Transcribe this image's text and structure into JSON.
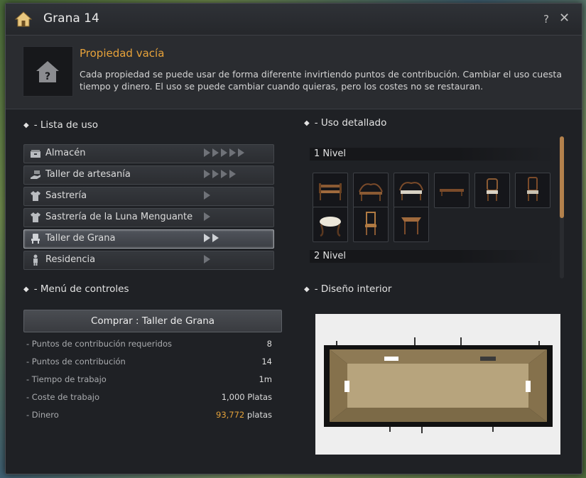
{
  "window": {
    "title": "Grana 14",
    "help_label": "?",
    "close_label": "✕"
  },
  "info": {
    "title": "Propiedad vacía",
    "description": "Cada propiedad se puede usar de forma diferente invirtiendo puntos de contribución. Cambiar el uso cuesta tiempo y dinero. El uso se puede cambiar cuando quieras, pero los costes no se restauran."
  },
  "use_list": {
    "heading": "- Lista de uso",
    "items": [
      {
        "label": "Almacén",
        "icon": "storage-icon",
        "level": 5,
        "selected": false
      },
      {
        "label": "Taller de artesanía",
        "icon": "craft-hand-icon",
        "level": 4,
        "selected": false
      },
      {
        "label": "Sastrería",
        "icon": "shirt-icon",
        "level": 1,
        "selected": false
      },
      {
        "label": "Sastrería de la Luna Menguante",
        "icon": "shirt-icon",
        "level": 1,
        "selected": false
      },
      {
        "label": "Taller de Grana",
        "icon": "chair-icon",
        "level": 2,
        "selected": true
      },
      {
        "label": "Residencia",
        "icon": "person-icon",
        "level": 1,
        "selected": false
      }
    ]
  },
  "controls": {
    "heading": "- Menú de controles",
    "buy_label": "Comprar : Taller de Grana",
    "stats": [
      {
        "label": "- Puntos de contribución requeridos",
        "value": "8"
      },
      {
        "label": "- Puntos de contribución",
        "value": "14"
      },
      {
        "label": "- Tiempo de trabajo",
        "value": "1m"
      },
      {
        "label": "- Coste de trabajo",
        "value": "1,000 Platas"
      }
    ],
    "money_label": "- Dinero",
    "money_value": "93,772",
    "money_unit": "platas"
  },
  "detail": {
    "heading": "- Uso detallado",
    "level1_label": "1 Nivel",
    "level2_label": "2 Nivel",
    "items": [
      {
        "icon": "wooden-bench-icon"
      },
      {
        "icon": "ornate-bench-icon"
      },
      {
        "icon": "ornate-sofa-icon"
      },
      {
        "icon": "low-table-icon"
      },
      {
        "icon": "carved-chair-icon"
      },
      {
        "icon": "high-back-chair-icon"
      },
      {
        "icon": "cushion-stool-icon"
      },
      {
        "icon": "wicker-chair-icon"
      },
      {
        "icon": "side-table-icon"
      }
    ]
  },
  "interior": {
    "heading": "- Diseño interior"
  },
  "colors": {
    "accent_orange": "#e7a23a",
    "scroll_thumb": "#b3814c",
    "panel_bg": "#1f2125"
  }
}
